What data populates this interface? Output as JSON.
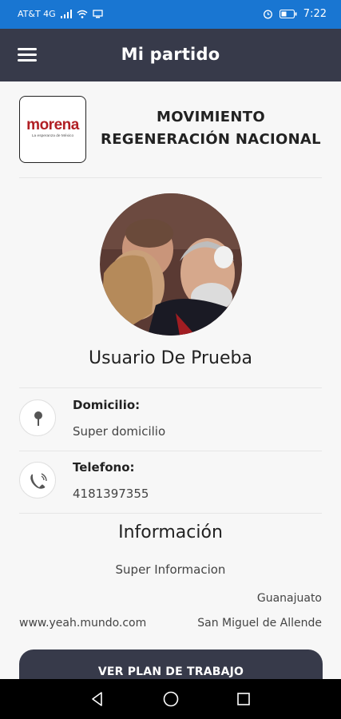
{
  "status_bar": {
    "carrier": "AT&T 4G",
    "time": "7:22",
    "color": "#1976d2"
  },
  "app_bar": {
    "title": "Mi partido",
    "menu_icon": "hamburger-menu-icon",
    "color": "#373a4a"
  },
  "party": {
    "logo_text": "morena",
    "logo_tagline": "La esperanza de México",
    "name_line1": "MOVIMIENTO",
    "name_line2": "REGENERACIÓN NACIONAL"
  },
  "user": {
    "name": "Usuario De Prueba"
  },
  "fields": {
    "domicilio_label": "Domicilio:",
    "domicilio_value": "Super domicilio",
    "domicilio_icon": "map-pin-icon",
    "telefono_label": "Telefono:",
    "telefono_value": "4181397355",
    "telefono_icon": "phone-icon"
  },
  "info": {
    "title": "Información",
    "text": "Super Informacion",
    "state": "Guanajuato",
    "website": "www.yeah.mundo.com",
    "city": "San Miguel de Allende"
  },
  "actions": {
    "plan_button": "VER PLAN DE TRABAJO"
  },
  "colors": {
    "brand_red": "#b11f24",
    "dark": "#373a4a"
  }
}
